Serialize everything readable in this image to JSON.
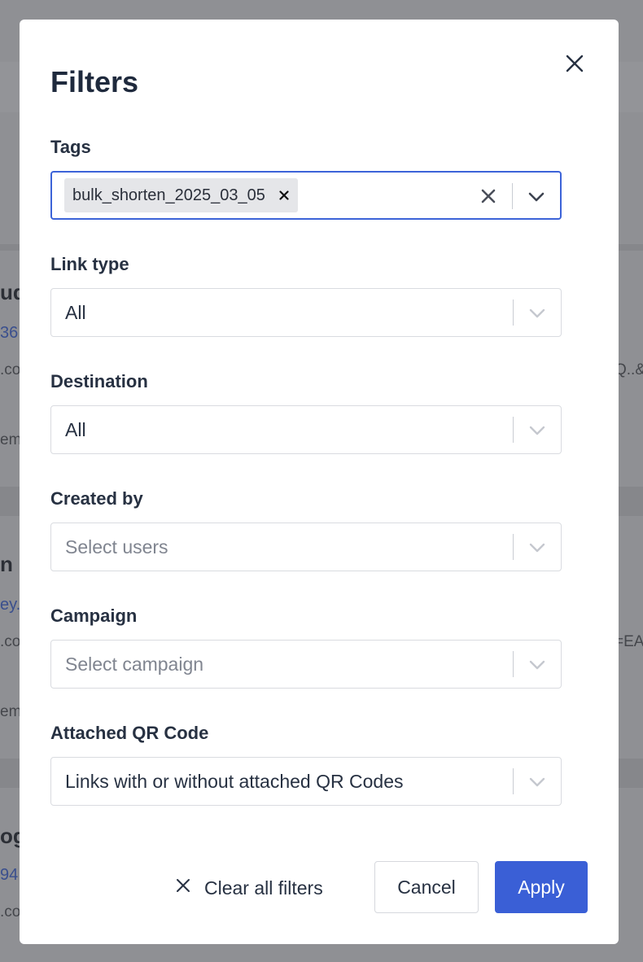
{
  "background": {
    "fragments": [
      {
        "text": "ud",
        "style": "bold"
      },
      {
        "text": "36",
        "style": "blue"
      },
      {
        "text": ".co",
        "style": "small"
      },
      {
        "text": "Q..&",
        "style": "small"
      },
      {
        "text": "em",
        "style": "small"
      },
      {
        "text": "n -",
        "style": "bold"
      },
      {
        "text": "ey.",
        "style": "blue"
      },
      {
        "text": ".co",
        "style": "small"
      },
      {
        "text": "=EA",
        "style": "small"
      },
      {
        "text": "em",
        "style": "small"
      },
      {
        "text": "og",
        "style": "bold"
      },
      {
        "text": "94",
        "style": "blue"
      },
      {
        "text": ".co",
        "style": "small"
      }
    ]
  },
  "modal": {
    "title": "Filters",
    "close_icon": "close-icon",
    "fields": {
      "tags": {
        "label": "Tags",
        "chips": [
          "bulk_shorten_2025_03_05"
        ]
      },
      "link_type": {
        "label": "Link type",
        "value": "All"
      },
      "destination": {
        "label": "Destination",
        "value": "All"
      },
      "created_by": {
        "label": "Created by",
        "placeholder": "Select users"
      },
      "campaign": {
        "label": "Campaign",
        "placeholder": "Select campaign"
      },
      "qr_code": {
        "label": "Attached QR Code",
        "value": "Links with or without attached QR Codes"
      }
    },
    "footer": {
      "clear_label": "Clear all filters",
      "cancel_label": "Cancel",
      "apply_label": "Apply"
    }
  },
  "colors": {
    "accent": "#3a5fd6",
    "focus_border": "#3c63d8",
    "overlay": "#8e8f93"
  }
}
